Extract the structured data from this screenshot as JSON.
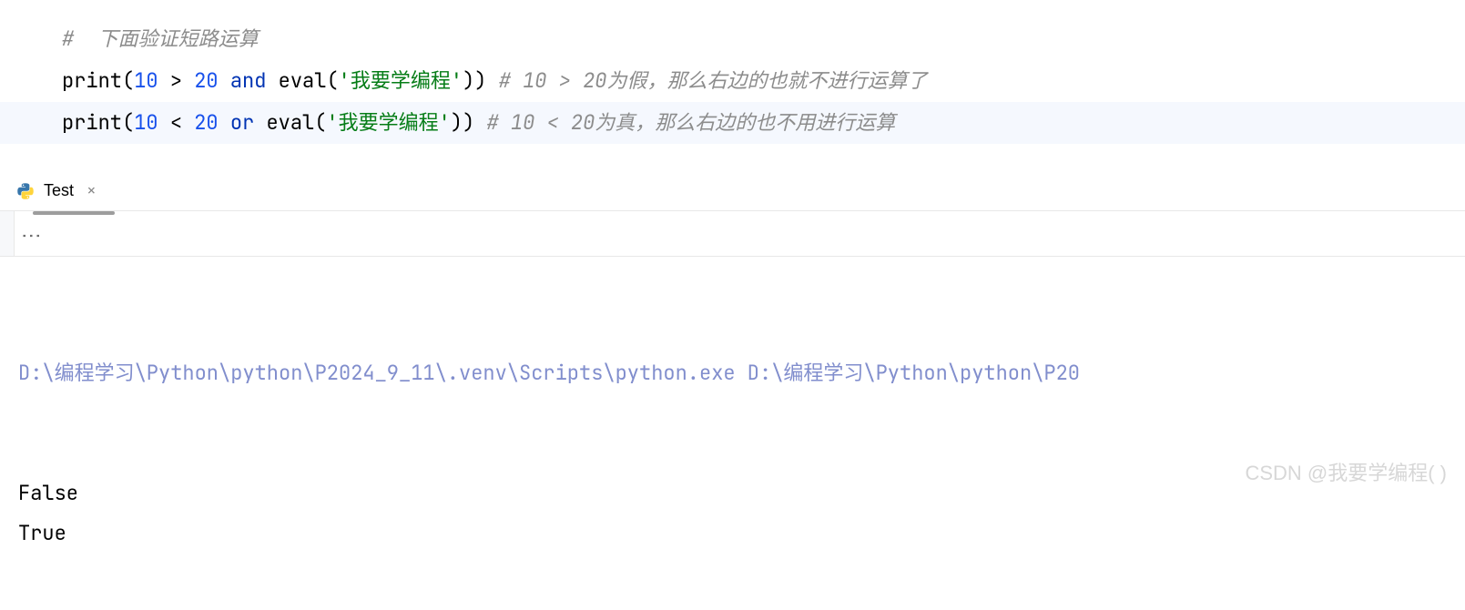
{
  "editor": {
    "lines": [
      {
        "highlighted": false,
        "tokens": [
          {
            "cls": "comment",
            "text": "#  下面验证短路运算"
          }
        ]
      },
      {
        "highlighted": false,
        "tokens": [
          {
            "cls": "func",
            "text": "print"
          },
          {
            "cls": "paren",
            "text": "("
          },
          {
            "cls": "number",
            "text": "10"
          },
          {
            "cls": "operator",
            "text": " > "
          },
          {
            "cls": "number",
            "text": "20"
          },
          {
            "cls": "operator",
            "text": " "
          },
          {
            "cls": "keyword",
            "text": "and"
          },
          {
            "cls": "operator",
            "text": " "
          },
          {
            "cls": "func",
            "text": "eval"
          },
          {
            "cls": "paren",
            "text": "("
          },
          {
            "cls": "string",
            "text": "'我要学编程'"
          },
          {
            "cls": "paren",
            "text": "))"
          },
          {
            "cls": "operator",
            "text": " "
          },
          {
            "cls": "comment",
            "text": "# 10 > 20为假，那么右边的也就不进行运算了"
          }
        ]
      },
      {
        "highlighted": true,
        "tokens": [
          {
            "cls": "func",
            "text": "print"
          },
          {
            "cls": "paren",
            "text": "("
          },
          {
            "cls": "number",
            "text": "10"
          },
          {
            "cls": "operator",
            "text": " < "
          },
          {
            "cls": "number",
            "text": "20"
          },
          {
            "cls": "operator",
            "text": " "
          },
          {
            "cls": "keyword",
            "text": "or"
          },
          {
            "cls": "operator",
            "text": " "
          },
          {
            "cls": "func",
            "text": "eval"
          },
          {
            "cls": "paren",
            "text": "("
          },
          {
            "cls": "string",
            "text": "'我要学编程'"
          },
          {
            "cls": "paren",
            "text": "))"
          },
          {
            "cls": "operator",
            "text": " "
          },
          {
            "cls": "comment",
            "text": "# 10 < 20为真，那么右边的也不用进行运算"
          }
        ]
      }
    ]
  },
  "tab": {
    "label": "Test",
    "icon": "python-icon"
  },
  "console": {
    "command": "D:\\编程学习\\Python\\python\\P2024_9_11\\.venv\\Scripts\\python.exe D:\\编程学习\\Python\\python\\P20",
    "output": [
      "False",
      "True"
    ]
  },
  "watermark": "CSDN @我要学编程(    )"
}
